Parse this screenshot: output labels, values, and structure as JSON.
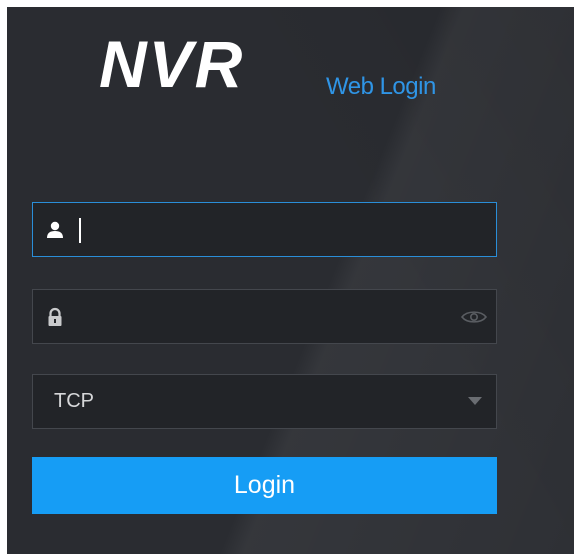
{
  "branding": {
    "logo_text": "NVR",
    "subtitle": "Web Login"
  },
  "form": {
    "username": {
      "icon": "user-icon",
      "value": "",
      "placeholder": ""
    },
    "password": {
      "icon": "lock-icon",
      "value": "",
      "placeholder": "",
      "toggle_icon": "eye-icon"
    },
    "protocol": {
      "selected": "TCP",
      "icon": "chevron-down-icon"
    },
    "login_label": "Login"
  },
  "colors": {
    "background": "#2a2c31",
    "accent": "#169df5",
    "subtitle": "#2f95e6",
    "active_border": "#2a8ed8"
  }
}
